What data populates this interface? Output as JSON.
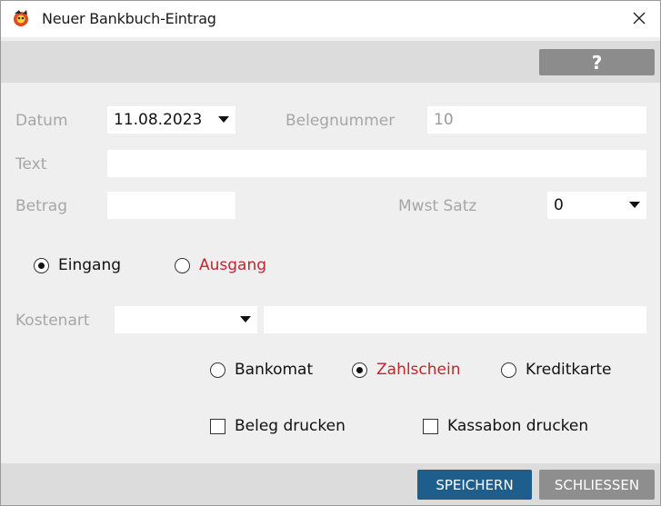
{
  "window": {
    "title": "Neuer Bankbuch-Eintrag"
  },
  "toolbar": {
    "help_label": "?"
  },
  "form": {
    "datum_label": "Datum",
    "datum_value": "11.08.2023",
    "belegnummer_label": "Belegnummer",
    "belegnummer_value": "10",
    "text_label": "Text",
    "text_value": "",
    "betrag_label": "Betrag",
    "betrag_value": "",
    "mwst_label": "Mwst Satz",
    "mwst_value": "0",
    "kostenart_label": "Kostenart",
    "kostenart_value": "",
    "kostenart_text": ""
  },
  "direction": {
    "options": [
      {
        "label": "Eingang",
        "checked": true
      },
      {
        "label": "Ausgang",
        "checked": false
      }
    ]
  },
  "payment": {
    "options": [
      {
        "label": "Bankomat",
        "checked": false
      },
      {
        "label": "Zahlschein",
        "checked": true
      },
      {
        "label": "Kreditkarte",
        "checked": false
      }
    ]
  },
  "print": {
    "beleg_label": "Beleg drucken",
    "kassabon_label": "Kassabon drucken"
  },
  "footer": {
    "save_label": "SPEICHERN",
    "close_label": "SCHLIESSEN"
  },
  "colors": {
    "accent_red": "#c0262d",
    "primary_button": "#1d5e8c",
    "secondary_button": "#8e8e8e"
  }
}
